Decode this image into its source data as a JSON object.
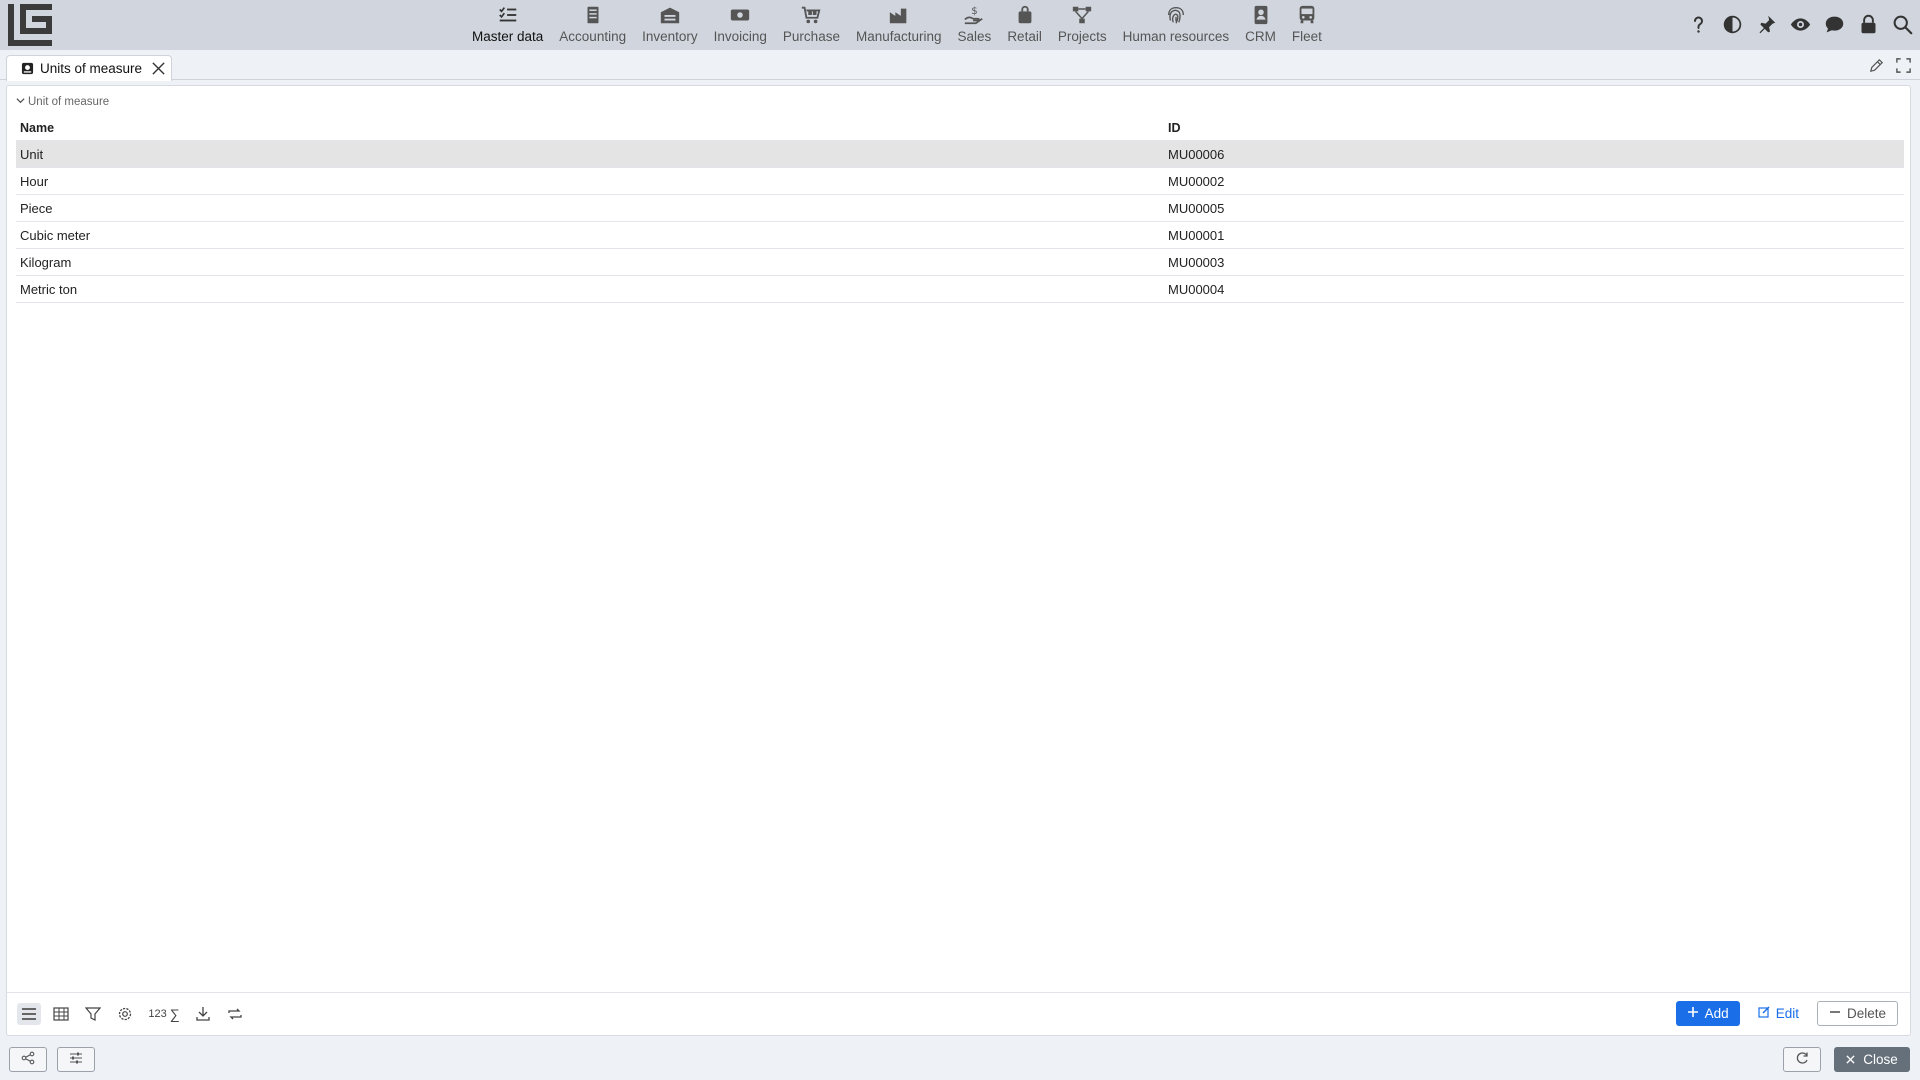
{
  "topbar": {
    "modules": [
      {
        "label": "Master data",
        "icon": "checklist-icon",
        "active": true
      },
      {
        "label": "Accounting",
        "icon": "ledger-icon"
      },
      {
        "label": "Inventory",
        "icon": "warehouse-icon"
      },
      {
        "label": "Invoicing",
        "icon": "banknote-icon"
      },
      {
        "label": "Purchase",
        "icon": "cart-icon"
      },
      {
        "label": "Manufacturing",
        "icon": "factory-icon"
      },
      {
        "label": "Sales",
        "icon": "hand-coin-icon"
      },
      {
        "label": "Retail",
        "icon": "shopping-bag-icon"
      },
      {
        "label": "Projects",
        "icon": "project-tree-icon"
      },
      {
        "label": "Human resources",
        "icon": "fingerprint-icon"
      },
      {
        "label": "CRM",
        "icon": "contact-card-icon"
      },
      {
        "label": "Fleet",
        "icon": "bus-icon"
      }
    ],
    "tools": [
      "help-icon",
      "contrast-icon",
      "pin-icon",
      "eye-icon",
      "chat-icon",
      "lock-icon",
      "search-icon"
    ]
  },
  "tab": {
    "label": "Units of measure",
    "icon": "ruler-icon"
  },
  "section": {
    "label": "Unit of measure"
  },
  "table": {
    "columns": [
      "Name",
      "ID"
    ],
    "rows": [
      {
        "name": "Unit",
        "id": "MU00006",
        "selected": true
      },
      {
        "name": "Hour",
        "id": "MU00002"
      },
      {
        "name": "Piece",
        "id": "MU00005"
      },
      {
        "name": "Cubic meter",
        "id": "MU00001"
      },
      {
        "name": "Kilogram",
        "id": "MU00003"
      },
      {
        "name": "Metric ton",
        "id": "MU00004"
      }
    ]
  },
  "footer": {
    "sum_label": "123",
    "sum_symbol": "∑",
    "add_label": "Add",
    "edit_label": "Edit",
    "delete_label": "Delete"
  },
  "bottombar": {
    "close_label": "Close"
  },
  "colors": {
    "accent": "#1a6fe8",
    "topbar": "#d1d6de",
    "selected_row": "#e4e4e4"
  }
}
